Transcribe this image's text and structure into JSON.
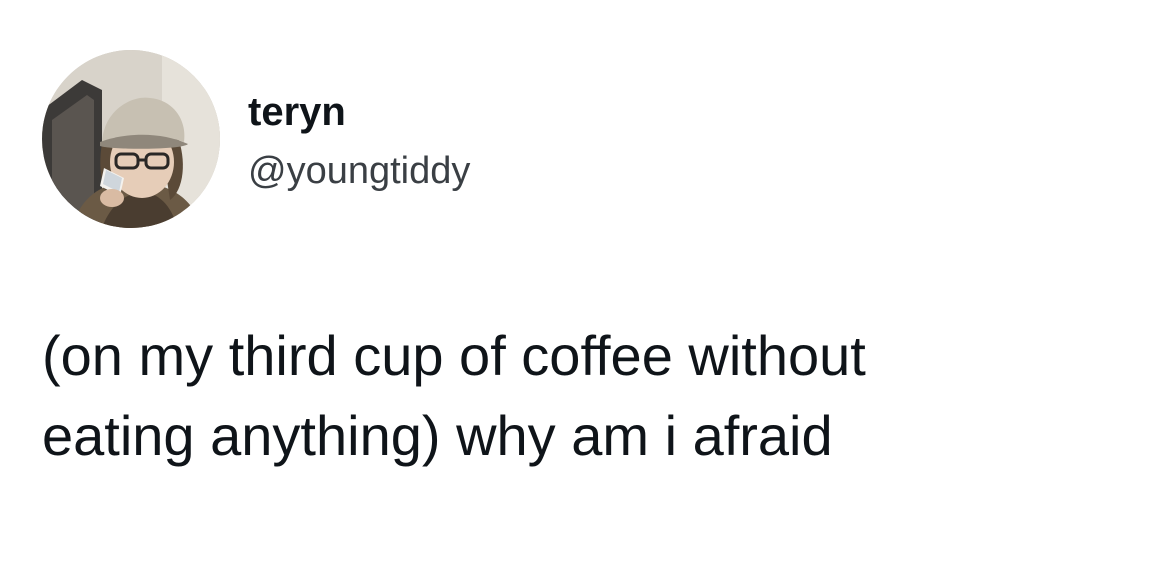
{
  "author": {
    "display_name": "teryn",
    "handle": "@youngtiddy",
    "avatar_icon": "profile-photo"
  },
  "tweet": {
    "lines": [
      "(on my third cup of coffee without",
      "eating anything) why am i afraid"
    ]
  },
  "colors": {
    "background": "#ffffff",
    "text_primary": "#0f1419",
    "text_secondary": "#3a3f44"
  }
}
